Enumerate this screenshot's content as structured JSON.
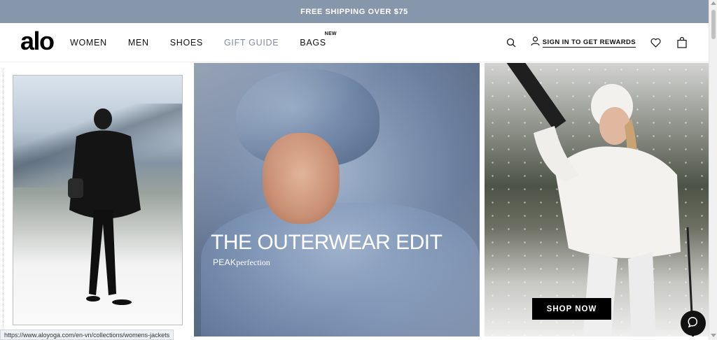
{
  "promo": {
    "text": "FREE SHIPPING OVER $75"
  },
  "header": {
    "logo": "alo",
    "nav": [
      {
        "label": "WOMEN"
      },
      {
        "label": "MEN"
      },
      {
        "label": "SHOES"
      },
      {
        "label": "GIFT GUIDE"
      },
      {
        "label": "BAGS",
        "badge": "NEW"
      }
    ],
    "signin_label": "SIGN IN TO GET REWARDS",
    "icons": [
      "search-icon",
      "user-icon",
      "heart-icon",
      "bag-icon"
    ]
  },
  "hero": {
    "headline": "THE OUTERWEAR EDIT",
    "subtitle_brand": "PEAK",
    "subtitle_script": "perfection",
    "cta_label": "SHOP NOW"
  },
  "status_bar": {
    "url": "https://www.aloyoga.com/en-vn/collections/womens-jackets"
  },
  "colors": {
    "promo_bg": "#8797ab",
    "accent_nav": "#7e8c9f",
    "cta_bg": "#000000"
  }
}
